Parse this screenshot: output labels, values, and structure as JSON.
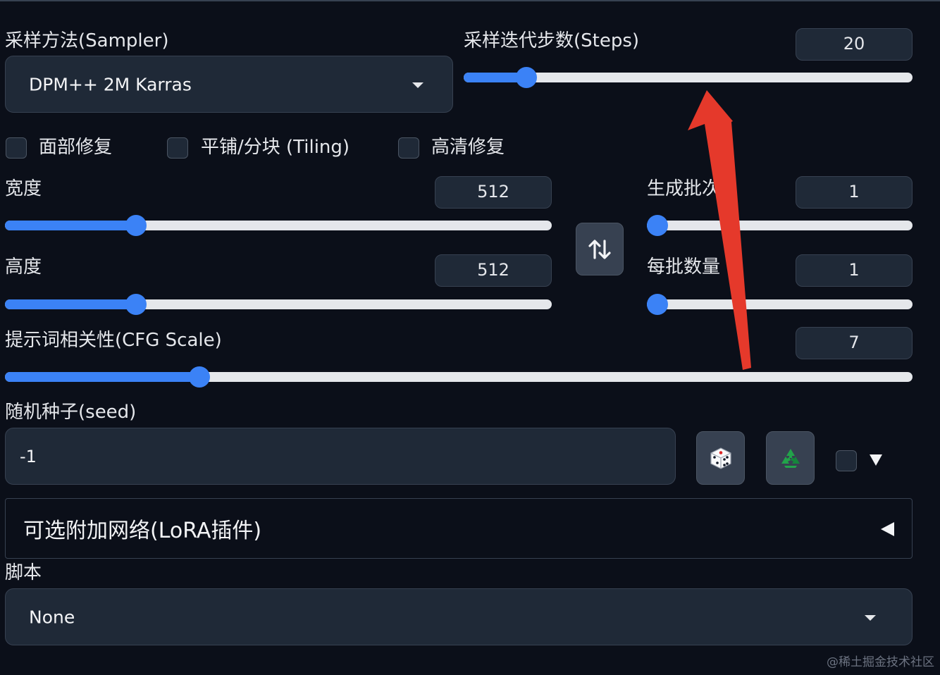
{
  "sampler": {
    "label": "采样方法(Sampler)",
    "value": "DPM++ 2M Karras"
  },
  "steps": {
    "label": "采样迭代步数(Steps)",
    "value": "20",
    "fraction": 0.14
  },
  "options": {
    "face_restore": "面部修复",
    "tiling": "平铺/分块 (Tiling)",
    "hires_fix": "高清修复"
  },
  "width": {
    "label": "宽度",
    "value": "512",
    "fraction": 0.24
  },
  "height": {
    "label": "高度",
    "value": "512",
    "fraction": 0.24
  },
  "batch_count": {
    "label": "生成批次",
    "value": "1",
    "fraction": 0.0
  },
  "batch_size": {
    "label": "每批数量",
    "value": "1",
    "fraction": 0.0
  },
  "cfg": {
    "label": "提示词相关性(CFG Scale)",
    "value": "7",
    "fraction": 0.214
  },
  "seed": {
    "label": "随机种子(seed)",
    "value": "-1"
  },
  "lora": {
    "title": "可选附加网络(LoRA插件)"
  },
  "script": {
    "label": "脚本",
    "value": "None"
  },
  "icons": {
    "swap": "swap-arrows-icon",
    "dice": "dice-icon",
    "recycle": "recycle-icon"
  },
  "annotation": {
    "arrow_color": "#e5392b"
  },
  "watermark": "@稀土掘金技术社区",
  "colors": {
    "background": "#0b0f19",
    "accent": "#3b82f6",
    "panel": "#1f2937"
  }
}
